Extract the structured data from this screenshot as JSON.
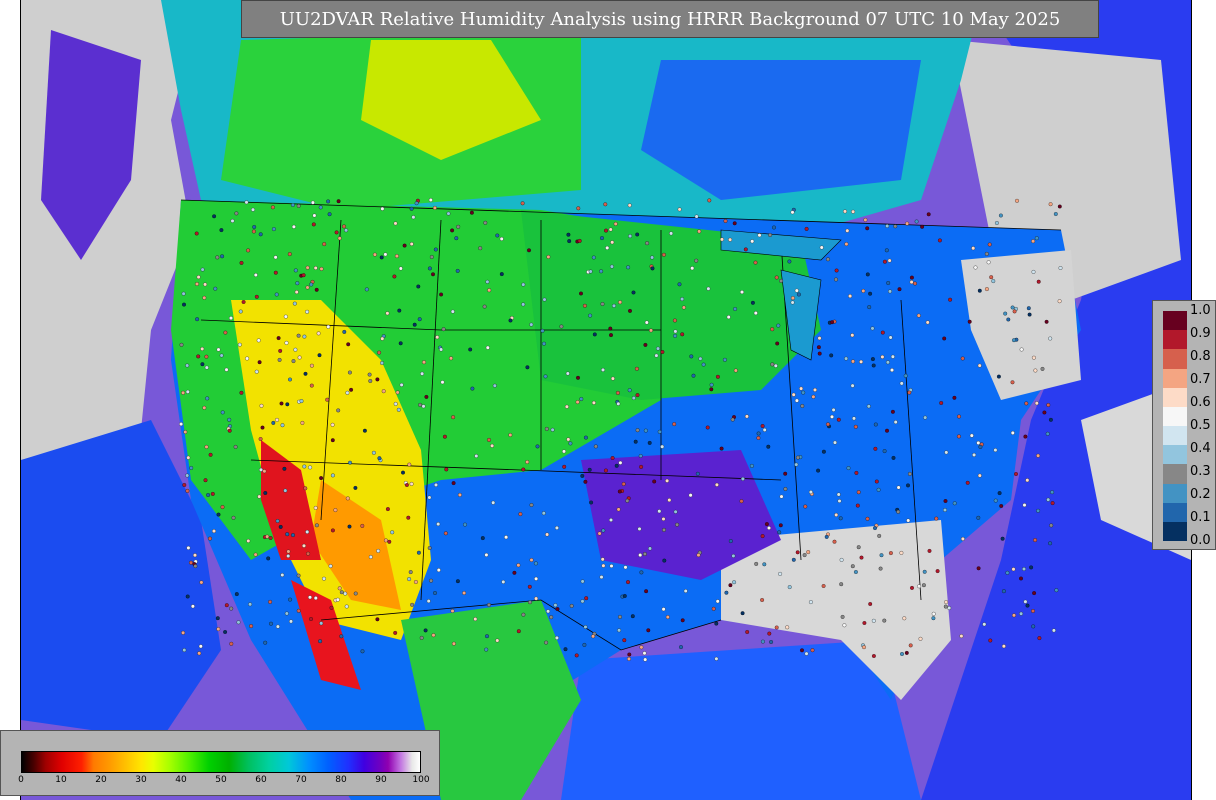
{
  "title": "UU2DVAR Relative Humidity Analysis using HRRR Background 07 UTC 10 May 2025",
  "legend_right": {
    "ticks": [
      "1.0",
      "0.9",
      "0.8",
      "0.7",
      "0.6",
      "0.5",
      "0.4",
      "0.3",
      "0.2",
      "0.1",
      "0.0"
    ],
    "colors": [
      "#67001f",
      "#b2182b",
      "#d6604d",
      "#f4a582",
      "#fddbc7",
      "#f7f7f7",
      "#d1e5f0",
      "#92c5de",
      "#878787",
      "#4393c3",
      "#2166ac",
      "#053061"
    ]
  },
  "legend_bottom": {
    "ticks": [
      "0",
      "10",
      "20",
      "30",
      "40",
      "50",
      "60",
      "70",
      "80",
      "90",
      "100"
    ]
  },
  "colors": {
    "ocean_purple": "#8a6fd0",
    "land_green": "#21c93a",
    "dry_yellow": "#f4e400",
    "very_dry_red": "#e0141e",
    "moist_blue": "#0a5cff",
    "humid_purple": "#6a20c8",
    "saturated_gray": "#d0d0d0",
    "title_bg": "#808080"
  }
}
